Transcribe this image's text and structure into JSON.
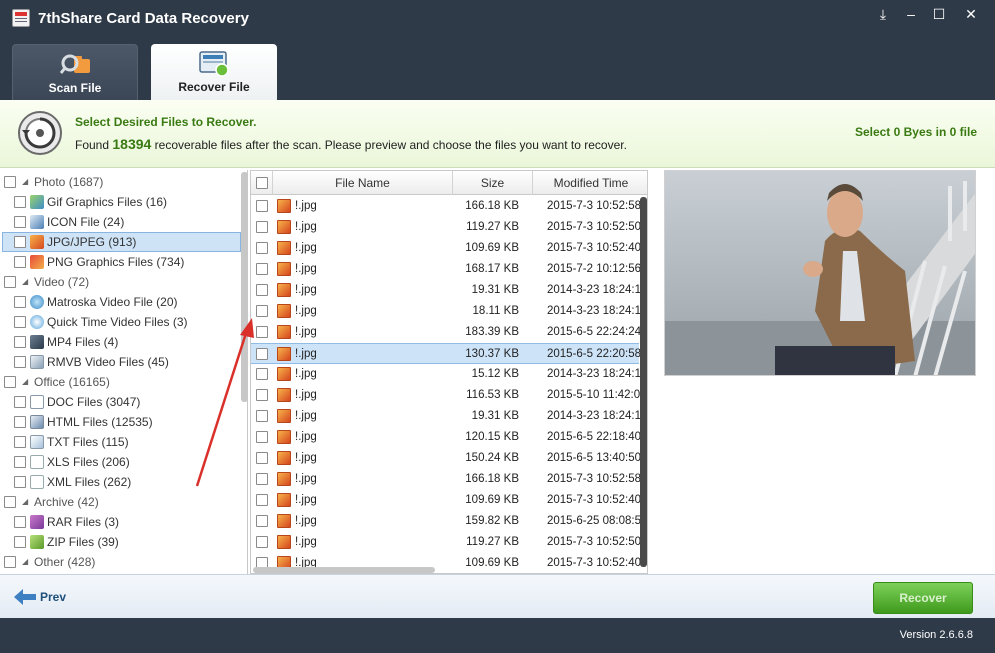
{
  "window": {
    "title": "7thShare Card Data Recovery",
    "buttons": [
      "download-icon",
      "minimize-icon",
      "maximize-icon",
      "close-icon"
    ]
  },
  "tabs": [
    {
      "label": "Scan File",
      "icon": "scan-file-icon",
      "active": false
    },
    {
      "label": "Recover File",
      "icon": "recover-file-icon",
      "active": true
    }
  ],
  "banner": {
    "heading": "Select Desired Files to Recover.",
    "text_before": "Found",
    "count": "18394",
    "text_after": "recoverable files after the scan. Please preview and choose the files you want to recover.",
    "selection": "Select 0 Byes in 0 file"
  },
  "tree": {
    "categories": [
      {
        "label": "Photo (1687)",
        "children": [
          {
            "label": "Gif Graphics Files (16)",
            "icon": "gif-file-icon"
          },
          {
            "label": "ICON File (24)",
            "icon": "icon-file-icon"
          },
          {
            "label": "JPG/JPEG (913)",
            "icon": "jpg-file-icon",
            "selected": true
          },
          {
            "label": "PNG Graphics Files (734)",
            "icon": "png-file-icon"
          }
        ]
      },
      {
        "label": "Video (72)",
        "children": [
          {
            "label": "Matroska Video File (20)",
            "icon": "mkv-file-icon"
          },
          {
            "label": "Quick Time Video Files (3)",
            "icon": "quicktime-file-icon"
          },
          {
            "label": "MP4 Files (4)",
            "icon": "mp4-file-icon"
          },
          {
            "label": "RMVB Video Files (45)",
            "icon": "rmvb-file-icon"
          }
        ]
      },
      {
        "label": "Office (16165)",
        "children": [
          {
            "label": "DOC Files (3047)",
            "icon": "doc-file-icon"
          },
          {
            "label": "HTML Files (12535)",
            "icon": "html-file-icon"
          },
          {
            "label": "TXT Files (115)",
            "icon": "txt-file-icon"
          },
          {
            "label": "XLS Files (206)",
            "icon": "xls-file-icon"
          },
          {
            "label": "XML Files (262)",
            "icon": "xml-file-icon"
          }
        ]
      },
      {
        "label": "Archive (42)",
        "children": [
          {
            "label": "RAR Files (3)",
            "icon": "rar-file-icon"
          },
          {
            "label": "ZIP Files (39)",
            "icon": "zip-file-icon"
          }
        ]
      },
      {
        "label": "Other (428)",
        "children": []
      }
    ]
  },
  "table": {
    "columns": [
      "File Name",
      "Size",
      "Modified Time"
    ],
    "selected_row": 7,
    "rows": [
      [
        "!.jpg",
        "166.18 KB",
        "2015-7-3 10:52:58"
      ],
      [
        "!.jpg",
        "119.27 KB",
        "2015-7-3 10:52:50"
      ],
      [
        "!.jpg",
        "109.69 KB",
        "2015-7-3 10:52:40"
      ],
      [
        "!.jpg",
        "168.17 KB",
        "2015-7-2 10:12:56"
      ],
      [
        "!.jpg",
        "19.31 KB",
        "2014-3-23 18:24:18"
      ],
      [
        "!.jpg",
        "18.11 KB",
        "2014-3-23 18:24:10"
      ],
      [
        "!.jpg",
        "183.39 KB",
        "2015-6-5 22:24:24"
      ],
      [
        "!.jpg",
        "130.37 KB",
        "2015-6-5 22:20:58"
      ],
      [
        "!.jpg",
        "15.12 KB",
        "2014-3-23 18:24:14"
      ],
      [
        "!.jpg",
        "116.53 KB",
        "2015-5-10 11:42:02"
      ],
      [
        "!.jpg",
        "19.31 KB",
        "2014-3-23 18:24:18"
      ],
      [
        "!.jpg",
        "120.15 KB",
        "2015-6-5 22:18:40"
      ],
      [
        "!.jpg",
        "150.24 KB",
        "2015-6-5 13:40:50"
      ],
      [
        "!.jpg",
        "166.18 KB",
        "2015-7-3 10:52:58"
      ],
      [
        "!.jpg",
        "109.69 KB",
        "2015-7-3 10:52:40"
      ],
      [
        "!.jpg",
        "159.82 KB",
        "2015-6-25 08:08:58"
      ],
      [
        "!.jpg",
        "119.27 KB",
        "2015-7-3 10:52:50"
      ],
      [
        "!.jpg",
        "109.69 KB",
        "2015-7-3 10:52:40"
      ]
    ]
  },
  "preview": {
    "icon": "image-preview"
  },
  "bottom": {
    "prev_label": "Prev",
    "recover_label": "Recover"
  },
  "footer": {
    "version": "Version 2.6.6.8"
  },
  "colors": {
    "accent_green": "#3a7a12",
    "chrome": "#2f3a48",
    "selection": "#cde3f8"
  }
}
